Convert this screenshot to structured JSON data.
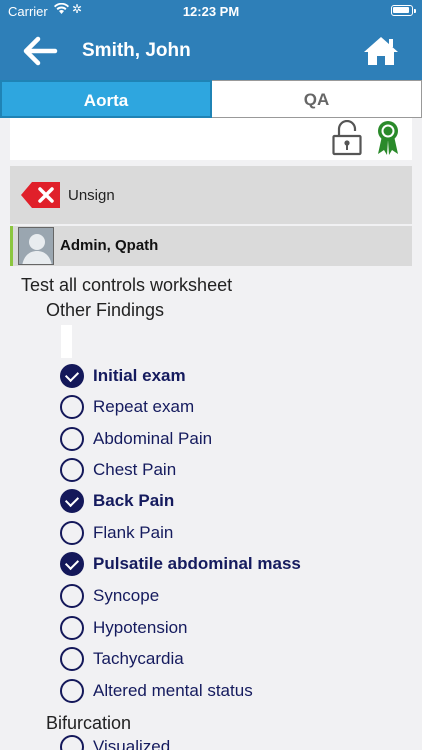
{
  "status": {
    "carrier": "Carrier",
    "time": "12:23 PM"
  },
  "header": {
    "title": "Smith, John",
    "back_icon": "arrow-left-icon",
    "home_icon": "home-icon"
  },
  "tabs": [
    {
      "label": "Aorta",
      "selected": true
    },
    {
      "label": "QA",
      "selected": false
    }
  ],
  "toolbar": {
    "lock_icon": "unlocked-padlock-icon",
    "ribbon_icon": "award-ribbon-icon",
    "ribbon_color": "#2a8a2a"
  },
  "unsign": {
    "label": "Unsign",
    "icon": "delete-x-icon",
    "icon_color": "#e0202a"
  },
  "user": {
    "name": "Admin, Qpath",
    "accent_color": "#8cc63f"
  },
  "worksheet": {
    "title": "Test all controls worksheet",
    "sections": [
      {
        "heading": "Other Findings",
        "options": [
          {
            "label": "Initial exam",
            "checked": true
          },
          {
            "label": "Repeat exam",
            "checked": false
          },
          {
            "label": "Abdominal Pain",
            "checked": false
          },
          {
            "label": "Chest Pain",
            "checked": false
          },
          {
            "label": "Back Pain",
            "checked": true
          },
          {
            "label": "Flank Pain",
            "checked": false
          },
          {
            "label": "Pulsatile abdominal mass",
            "checked": true
          },
          {
            "label": "Syncope",
            "checked": false
          },
          {
            "label": "Hypotension",
            "checked": false
          },
          {
            "label": "Tachycardia",
            "checked": false
          },
          {
            "label": "Altered mental status",
            "checked": false
          }
        ]
      },
      {
        "heading": "Bifurcation",
        "options": [
          {
            "label": "Visualized",
            "checked": false
          }
        ]
      }
    ]
  },
  "colors": {
    "header_bg": "#2e7fb8",
    "tab_active": "#2ea6df",
    "option_text": "#151b5e"
  }
}
